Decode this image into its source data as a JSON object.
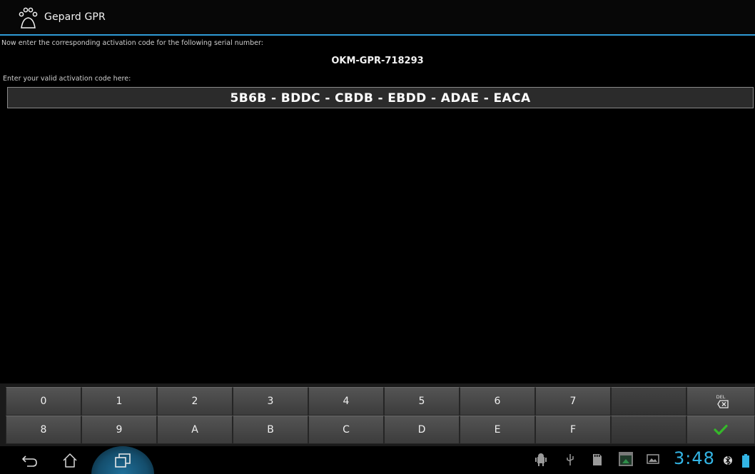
{
  "app": {
    "title": "Gepard GPR",
    "accent": "#2f9bd6",
    "icon": "paw-icon"
  },
  "prompt_serial": "Now enter the corresponding activation code for the following serial number:",
  "serial_number": "OKM-GPR-718293",
  "prompt_code": "Enter your valid activation code here:",
  "activation_code": "5B6B - BDDC - CBDB - EBDD - ADAE - EACA",
  "keypad": {
    "row1": [
      "0",
      "1",
      "2",
      "3",
      "4",
      "5",
      "6",
      "7",
      "",
      "DEL"
    ],
    "row2": [
      "8",
      "9",
      "A",
      "B",
      "C",
      "D",
      "E",
      "F",
      "",
      "confirm"
    ],
    "del_label": "DEL",
    "confirm_icon": "checkmark-icon",
    "confirm_color": "#35b82a"
  },
  "navbar": {
    "back_icon": "back-icon",
    "home_icon": "home-icon",
    "recent_icon": "recent-apps-icon",
    "status_icons": [
      "android-debug-icon",
      "usb-icon",
      "sd-card-icon",
      "screenshot-icon",
      "gallery-icon"
    ],
    "clock": "3:48",
    "clock_color": "#33b5e5",
    "bluetooth_icon": "bluetooth-icon",
    "battery_icon": "battery-icon"
  }
}
